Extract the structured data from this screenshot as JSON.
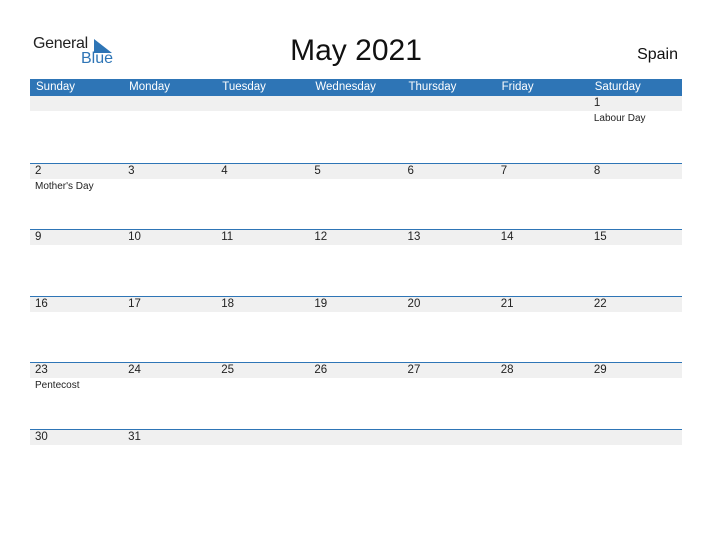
{
  "logo": {
    "line1": "General",
    "line2": "Blue"
  },
  "title": "May 2021",
  "country": "Spain",
  "colors": {
    "accent": "#2e75b6",
    "strip": "#f0f0f0"
  },
  "weekdays": [
    "Sunday",
    "Monday",
    "Tuesday",
    "Wednesday",
    "Thursday",
    "Friday",
    "Saturday"
  ],
  "weeks": [
    [
      {
        "d": ""
      },
      {
        "d": ""
      },
      {
        "d": ""
      },
      {
        "d": ""
      },
      {
        "d": ""
      },
      {
        "d": ""
      },
      {
        "d": "1",
        "h": "Labour Day"
      }
    ],
    [
      {
        "d": "2",
        "h": "Mother's Day"
      },
      {
        "d": "3"
      },
      {
        "d": "4"
      },
      {
        "d": "5"
      },
      {
        "d": "6"
      },
      {
        "d": "7"
      },
      {
        "d": "8"
      }
    ],
    [
      {
        "d": "9"
      },
      {
        "d": "10"
      },
      {
        "d": "11"
      },
      {
        "d": "12"
      },
      {
        "d": "13"
      },
      {
        "d": "14"
      },
      {
        "d": "15"
      }
    ],
    [
      {
        "d": "16"
      },
      {
        "d": "17"
      },
      {
        "d": "18"
      },
      {
        "d": "19"
      },
      {
        "d": "20"
      },
      {
        "d": "21"
      },
      {
        "d": "22"
      }
    ],
    [
      {
        "d": "23",
        "h": "Pentecost"
      },
      {
        "d": "24"
      },
      {
        "d": "25"
      },
      {
        "d": "26"
      },
      {
        "d": "27"
      },
      {
        "d": "28"
      },
      {
        "d": "29"
      }
    ],
    [
      {
        "d": "30"
      },
      {
        "d": "31"
      },
      {
        "d": ""
      },
      {
        "d": ""
      },
      {
        "d": ""
      },
      {
        "d": ""
      },
      {
        "d": ""
      }
    ]
  ]
}
